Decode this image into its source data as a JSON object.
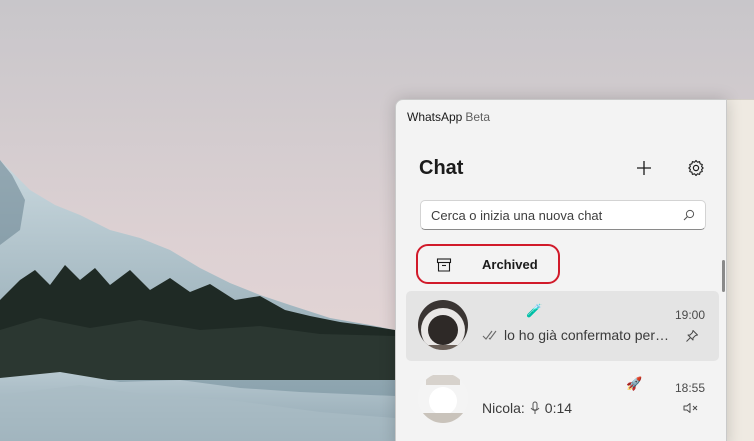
{
  "window": {
    "app_name": "WhatsApp",
    "badge": "Beta"
  },
  "header": {
    "title": "Chat",
    "new_chat_icon": "plus-icon",
    "settings_icon": "gear-icon"
  },
  "search": {
    "placeholder": "Cerca o inizia una nuova chat",
    "value": ""
  },
  "archived": {
    "label": "Archived",
    "icon": "archive-box-icon",
    "highlight_color": "#d11a2a"
  },
  "chats": [
    {
      "name_emoji": "🧪",
      "preview": "lo ho già confermato per…",
      "status_icon": "double-check-icon",
      "time": "19:00",
      "meta_icon": "pin-icon",
      "selected": true
    },
    {
      "name_emoji": "🚀",
      "sender": "Nicola:",
      "preview": "0:14",
      "status_icon": "microphone-icon",
      "time": "18:55",
      "meta_icon": "muted-icon",
      "selected": false
    }
  ]
}
